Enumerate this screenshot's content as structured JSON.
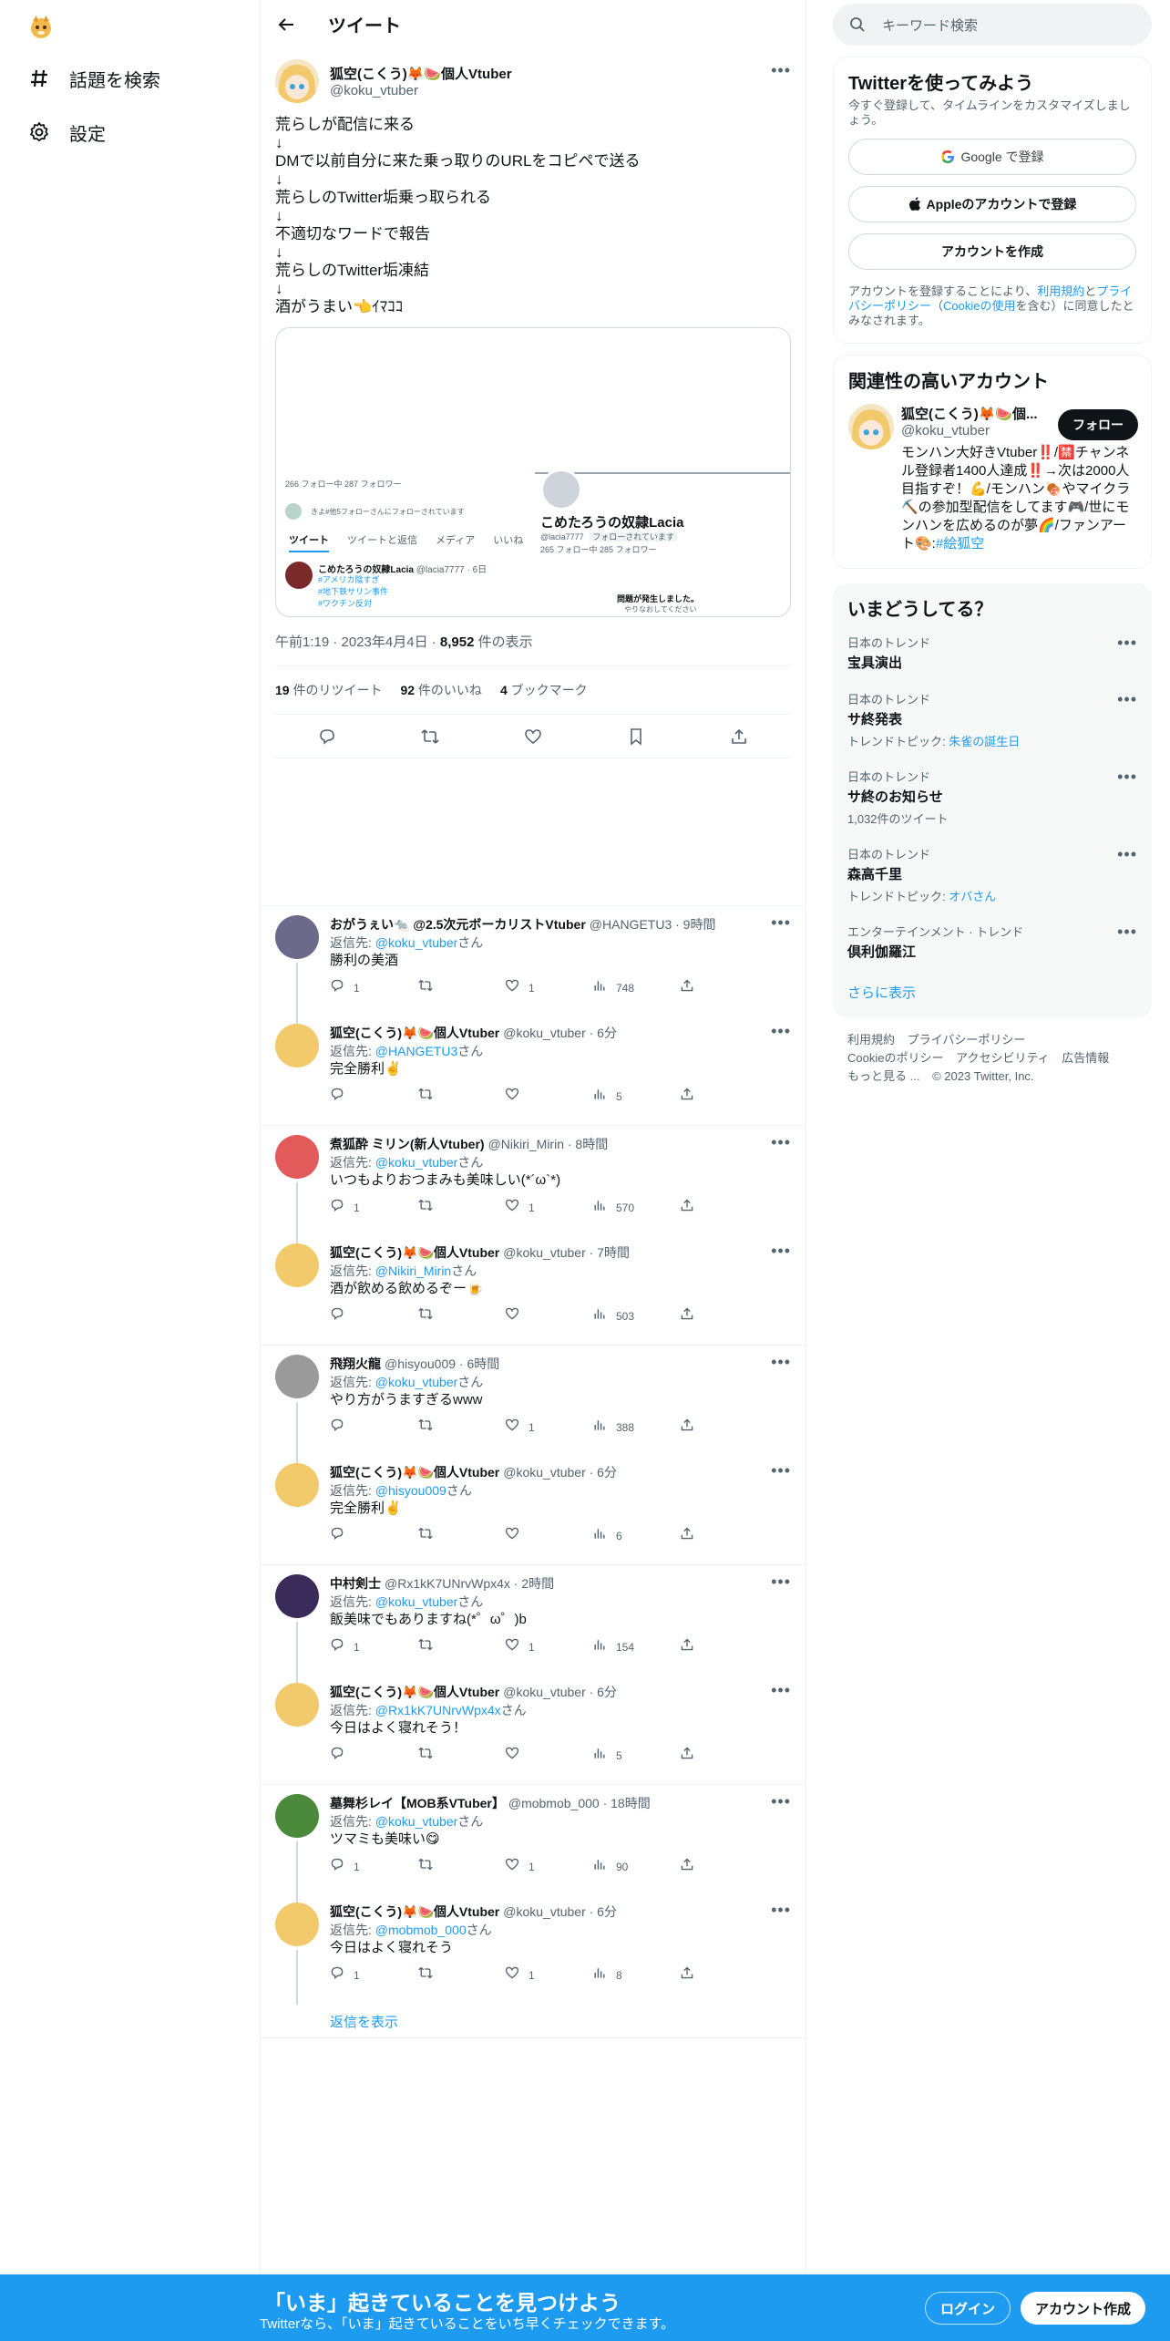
{
  "nav": {
    "explore_label": "話題を検索",
    "settings_label": "設定"
  },
  "header": {
    "title": "ツイート"
  },
  "focal": {
    "display_name": "狐空(こくう)🦊🍉個人Vtuber",
    "username": "@koku_vtuber",
    "text": "荒らしが配信に来る\n↓\nDMで以前自分に来た乗っ取りのURLをコピペで送る\n↓\n荒らしのTwitter垢乗っ取られる\n↓\n不適切なワードで報告\n↓\n荒らしのTwitter垢凍結\n↓\n酒がうまい👈ｲﾏｺｺ",
    "media": {
      "stats_left": "266 フォロー中   287 フォロワー",
      "followed_by": "きよ#他5フォローさんにフォローされています",
      "tabs": [
        "ツイート",
        "ツイートと返信",
        "メディア",
        "いいね"
      ],
      "profile_name": "こめたろうの奴隷Lacia",
      "profile_handle": "@lacia7777",
      "profile_follows_you": "フォローされています",
      "profile_stats": "265 フォロー中   285 フォロワー",
      "tweet_name": "こめたろうの奴隷Lacia",
      "tweet_handle": "@lacia7777 · 6日",
      "tweet_tags": [
        "#アメリカ陰すぎ",
        "#地下鉄サリン事件",
        "#ワクチン反対"
      ],
      "error_title": "問題が発生しました。",
      "error_sub": "やりなおしてください"
    },
    "time": "午前1:19 · 2023年4月4日 · ",
    "views_count": "8,952",
    "views_label": " 件の表示",
    "retweets": "19",
    "retweets_label": " 件のリツイート",
    "likes": "92",
    "likes_label": " 件のいいね",
    "bookmarks": "4",
    "bookmarks_label": " ブックマーク"
  },
  "replies": [
    {
      "name": "おがうぇい🐀 @2.5次元ボーカリストVtuber",
      "handle": "@HANGETU3 · 9時間",
      "reply_to": "@koku_vtuber",
      "text": "勝利の美酒",
      "replies": "1",
      "rts": "",
      "likes": "1",
      "views": "748",
      "avatar_color": "#6b6a8a",
      "line": true
    },
    {
      "name": "狐空(こくう)🦊🍉個人Vtuber",
      "handle": "@koku_vtuber · 6分",
      "reply_to": "@HANGETU3",
      "text": "完全勝利✌️",
      "replies": "",
      "rts": "",
      "likes": "",
      "views": "5",
      "avatar_color": "#f2c96b",
      "line": false
    },
    {
      "name": "煮狐酔 ミリン(新人Vtuber)",
      "handle": "@Nikiri_Mirin · 8時間",
      "reply_to": "@koku_vtuber",
      "text": "いつもよりおつまみも美味しい(*´ω`*)",
      "replies": "1",
      "rts": "",
      "likes": "1",
      "views": "570",
      "avatar_color": "#e25a5a",
      "line": true
    },
    {
      "name": "狐空(こくう)🦊🍉個人Vtuber",
      "handle": "@koku_vtuber · 7時間",
      "reply_to": "@Nikiri_Mirin",
      "text": "酒が飲める飲めるぞー🍺",
      "replies": "",
      "rts": "",
      "likes": "",
      "views": "503",
      "avatar_color": "#f2c96b",
      "line": false
    },
    {
      "name": "飛翔火龍",
      "handle": "@hisyou009 · 6時間",
      "reply_to": "@koku_vtuber",
      "text": "やり方がうますぎるwww",
      "replies": "",
      "rts": "",
      "likes": "1",
      "views": "388",
      "avatar_color": "#9a9a9a",
      "line": true
    },
    {
      "name": "狐空(こくう)🦊🍉個人Vtuber",
      "handle": "@koku_vtuber · 6分",
      "reply_to": "@hisyou009",
      "text": "完全勝利✌️",
      "replies": "",
      "rts": "",
      "likes": "",
      "views": "6",
      "avatar_color": "#f2c96b",
      "line": false
    },
    {
      "name": "中村剣士",
      "handle": "@Rx1kK7UNrvWpx4x · 2時間",
      "reply_to": "@koku_vtuber",
      "text": "飯美味でもありますね(*゜ω゜)b",
      "replies": "1",
      "rts": "",
      "likes": "1",
      "views": "154",
      "avatar_color": "#3a2b5a",
      "line": true
    },
    {
      "name": "狐空(こくう)🦊🍉個人Vtuber",
      "handle": "@koku_vtuber · 6分",
      "reply_to": "@Rx1kK7UNrvWpx4x",
      "text": "今日はよく寝れそう！",
      "replies": "",
      "rts": "",
      "likes": "",
      "views": "5",
      "avatar_color": "#f2c96b",
      "line": false
    },
    {
      "name": "墓舞杉レイ【MOB系VTuber】",
      "handle": "@mobmob_000 · 18時間",
      "reply_to": "@koku_vtuber",
      "text": "ツマミも美味い😋",
      "replies": "1",
      "rts": "",
      "likes": "1",
      "views": "90",
      "avatar_color": "#4a8a3a",
      "line": true
    },
    {
      "name": "狐空(こくう)🦊🍉個人Vtuber",
      "handle": "@koku_vtuber · 6分",
      "reply_to": "@mobmob_000",
      "text": "今日はよく寝れそう",
      "replies": "1",
      "rts": "",
      "likes": "1",
      "views": "8",
      "avatar_color": "#f2c96b",
      "line": false
    }
  ],
  "reply_prefix": "返信先: ",
  "reply_suffix": "さん",
  "show_replies": "返信を表示",
  "search": {
    "placeholder": "キーワード検索"
  },
  "signup_card": {
    "title": "Twitterを使ってみよう",
    "subtitle": "今すぐ登録して、タイムラインをカスタマイズしましょう。",
    "google": "Google で登録",
    "apple": "Appleのアカウントで登録",
    "create": "アカウントを作成",
    "terms_pre": "アカウントを登録することにより、",
    "terms_link1": "利用規約",
    "terms_mid1": "と",
    "terms_link2": "プライバシーポリシー",
    "terms_mid2": "（",
    "terms_link3": "Cookieの使用",
    "terms_post": "を含む）に同意したとみなされます。"
  },
  "related": {
    "title": "関連性の高いアカウント",
    "name": "狐空(こくう)🦊🍉個...",
    "handle": "@koku_vtuber",
    "follow": "フォロー",
    "bio": "モンハン大好きVtuber‼️/🈲チャンネル登録者1400人達成‼️→次は2000人目指すぞ！💪/モンハン🍖やマイクラ⛏️の参加型配信をしてます🎮/世にモンハンを広めるのが夢🌈/ファンアート🎨:",
    "bio_tag": "#絵狐空"
  },
  "trends": {
    "title": "いまどうしてる？",
    "items": [
      {
        "ctx": "日本のトレンド",
        "name": "宝具演出",
        "sub_pre": "",
        "sub_link": ""
      },
      {
        "ctx": "日本のトレンド",
        "name": "サ終発表",
        "sub_pre": "トレンドトピック: ",
        "sub_link": "朱雀の誕生日"
      },
      {
        "ctx": "日本のトレンド",
        "name": "サ終のお知らせ",
        "sub_pre": "1,032件のツイート",
        "sub_link": ""
      },
      {
        "ctx": "日本のトレンド",
        "name": "森高千里",
        "sub_pre": "トレンドトピック: ",
        "sub_link": "オバさん"
      },
      {
        "ctx": "エンターテインメント · トレンド",
        "name": "倶利伽羅江",
        "sub_pre": "",
        "sub_link": ""
      }
    ],
    "show_more": "さらに表示"
  },
  "footer": {
    "links": [
      "利用規約",
      "プライバシーポリシー",
      "Cookieのポリシー",
      "アクセシビリティ",
      "広告情報",
      "もっと見る ...",
      "© 2023 Twitter, Inc."
    ]
  },
  "bottom": {
    "title": "「いま」起きていることを見つけよう",
    "subtitle": "Twitterなら、「いま」起きていることをいち早くチェックできます。",
    "login": "ログイン",
    "signup": "アカウント作成"
  },
  "colors": {
    "accent": "#1d9bf0",
    "text": "#0f1419",
    "muted": "#536471",
    "border": "#eff3f4"
  }
}
